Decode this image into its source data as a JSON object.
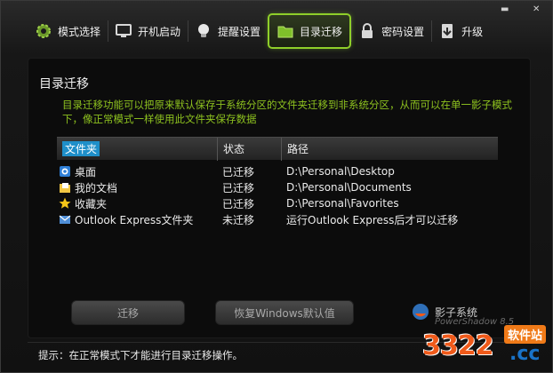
{
  "window_controls": [
    "minimize-icon",
    "close-icon"
  ],
  "tabs": [
    {
      "label": "模式选择",
      "icon": "gear-icon",
      "active": false
    },
    {
      "label": "开机启动",
      "icon": "monitor-icon",
      "active": false
    },
    {
      "label": "提醒设置",
      "icon": "bulb-icon",
      "active": false
    },
    {
      "label": "目录迁移",
      "icon": "folder-icon",
      "active": true
    },
    {
      "label": "密码设置",
      "icon": "lock-icon",
      "active": false
    },
    {
      "label": "升级",
      "icon": "upgrade-icon",
      "active": false
    }
  ],
  "section": {
    "title": "目录迁移",
    "description": "目录迁移功能可以把原来默认保存于系统分区的文件夹迁移到非系统分区，从而可以在单一影子模式下，像正常模式一样使用此文件夹保存数据"
  },
  "table": {
    "headers": [
      "文件夹",
      "状态",
      "路径"
    ],
    "rows": [
      {
        "name": "桌面",
        "icon": "desktop-icon",
        "status": "已迁移",
        "path": "D:\\Personal\\Desktop"
      },
      {
        "name": "我的文档",
        "icon": "documents-icon",
        "status": "已迁移",
        "path": "D:\\Personal\\Documents"
      },
      {
        "name": "收藏夹",
        "icon": "star-icon",
        "status": "已迁移",
        "path": "D:\\Personal\\Favorites"
      },
      {
        "name": "Outlook Express文件夹",
        "icon": "outlook-icon",
        "status": "未迁移",
        "path": "运行Outlook Express后才可以迁移"
      }
    ]
  },
  "buttons": {
    "migrate": "迁移",
    "restore": "恢复Windows默认值"
  },
  "brand": {
    "name": "影子系统",
    "sub": "PowerShadow 8.5"
  },
  "hint": "提示：在正常模式下才能进行目录迁移操作。",
  "watermark": {
    "number": "3322",
    "domain": ".cc",
    "tag": "软件站"
  },
  "colors": {
    "accent_green": "#8ec21f",
    "selection_blue": "#1f8fc9",
    "watermark_orange": "#f05a1a"
  }
}
